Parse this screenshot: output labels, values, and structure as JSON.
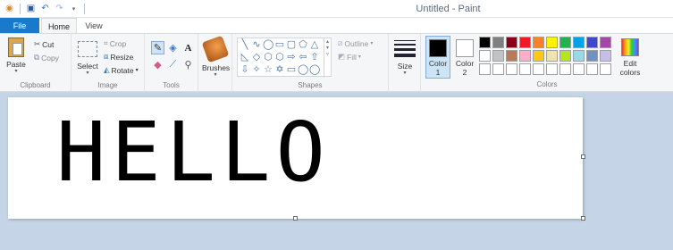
{
  "window": {
    "title": "Untitled - Paint"
  },
  "tabs": [
    {
      "label": "File"
    },
    {
      "label": "Home"
    },
    {
      "label": "View"
    }
  ],
  "clipboard": {
    "paste": "Paste",
    "cut": "Cut",
    "copy": "Copy",
    "group_label": "Clipboard"
  },
  "image": {
    "select": "Select",
    "crop": "Crop",
    "resize": "Resize",
    "rotate": "Rotate",
    "group_label": "Image"
  },
  "tools": {
    "group_label": "Tools",
    "items": [
      "pencil-icon",
      "fill-icon",
      "text-icon",
      "eraser-icon",
      "color-picker-icon",
      "magnifier-icon"
    ]
  },
  "brushes": {
    "label": "Brushes"
  },
  "shapes": {
    "outline": "Outline",
    "fill": "Fill",
    "group_label": "Shapes",
    "glyphs": [
      "╲",
      "∿",
      "◯",
      "▭",
      "▢",
      "⬠",
      "△",
      "◺",
      "◇",
      "⬡",
      "⬡",
      "⇨",
      "⇦",
      "⇧",
      "⇩",
      "✧",
      "☆",
      "✡",
      "▭",
      "◯",
      "◯"
    ]
  },
  "size": {
    "label": "Size"
  },
  "colors": {
    "color1_label": "Color",
    "color1_num": "1",
    "color2_label": "Color",
    "color2_num": "2",
    "color1": "#000000",
    "color2": "#ffffff",
    "edit_label": "Edit",
    "edit_label2": "colors",
    "group_label": "Colors",
    "palette": [
      "#000000",
      "#7f7f7f",
      "#880015",
      "#ed1c24",
      "#ff7f27",
      "#fff200",
      "#22b14c",
      "#00a2e8",
      "#3f48cc",
      "#a349a4",
      "#ffffff",
      "#c3c3c3",
      "#b97a57",
      "#ffaec9",
      "#ffc90e",
      "#efe4b0",
      "#b5e61d",
      "#99d9ea",
      "#7092be",
      "#c8bfe7",
      "#ffffff",
      "#ffffff",
      "#ffffff",
      "#ffffff",
      "#ffffff",
      "#ffffff",
      "#ffffff",
      "#ffffff",
      "#ffffff",
      "#ffffff"
    ]
  },
  "canvas": {
    "text": "HELLO"
  }
}
